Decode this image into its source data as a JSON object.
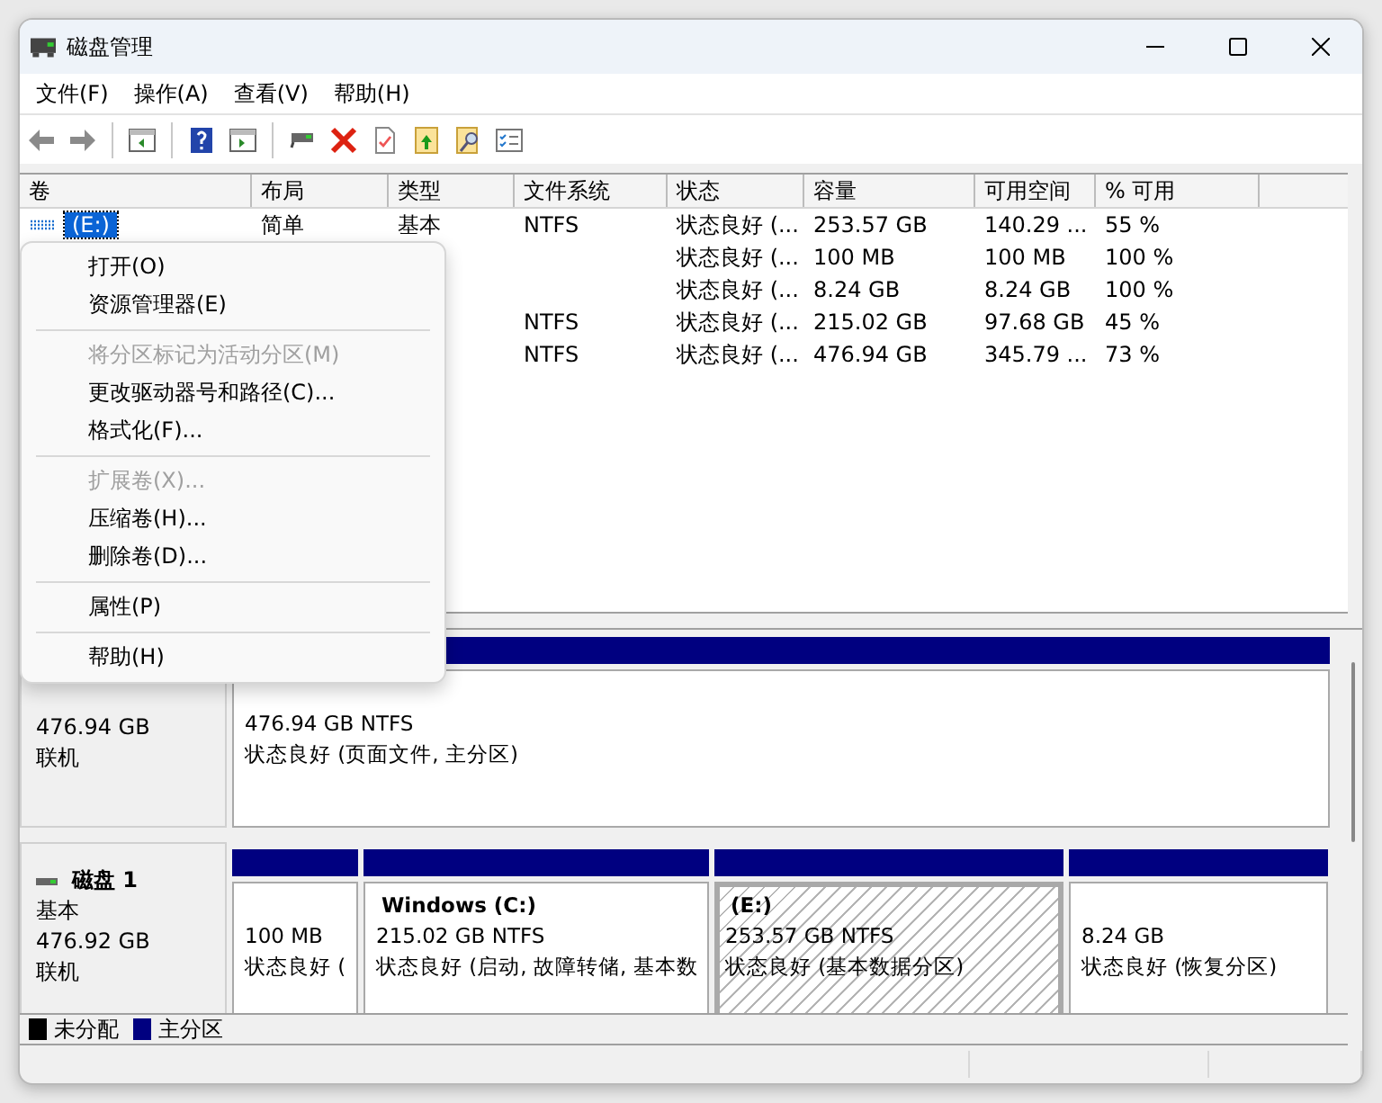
{
  "window": {
    "title": "磁盘管理"
  },
  "menu": [
    "文件(F)",
    "操作(A)",
    "查看(V)",
    "帮助(H)"
  ],
  "table": {
    "columns": [
      "卷",
      "布局",
      "类型",
      "文件系统",
      "状态",
      "容量",
      "可用空间",
      "% 可用"
    ],
    "rows": [
      {
        "selected": true,
        "volume": "(E:)",
        "layout": "简单",
        "type": "基本",
        "file_system": "NTFS",
        "status": "状态良好 (...",
        "capacity": "253.57 GB",
        "free_space": "140.29 ...",
        "percent_free": "55 %"
      },
      {
        "selected": false,
        "status": "状态良好 (...",
        "capacity": "100 MB",
        "free_space": "100 MB",
        "percent_free": "100 %"
      },
      {
        "selected": false,
        "status": "状态良好 (...",
        "capacity": "8.24 GB",
        "free_space": "8.24 GB",
        "percent_free": "100 %"
      },
      {
        "selected": false,
        "file_system": "NTFS",
        "status": "状态良好 (...",
        "capacity": "215.02 GB",
        "free_space": "97.68 GB",
        "percent_free": "45 %"
      },
      {
        "selected": false,
        "file_system": "NTFS",
        "status": "状态良好 (...",
        "capacity": "476.94 GB",
        "free_space": "345.79 ...",
        "percent_free": "73 %"
      }
    ]
  },
  "disks": [
    {
      "size": "476.94 GB",
      "status": "联机",
      "partitions": [
        {
          "size_fs": "476.94 GB NTFS",
          "state": "状态良好 (页面文件, 主分区)",
          "selected": false
        }
      ]
    },
    {
      "name": "磁盘 1",
      "type": "基本",
      "size": "476.92 GB",
      "status": "联机",
      "partitions": [
        {
          "size_fs": "100 MB",
          "state": "状态良好 (",
          "selected": false
        },
        {
          "label": "Windows  (C:)",
          "size_fs": "215.02 GB NTFS",
          "state": "状态良好 (启动, 故障转储, 基本数",
          "selected": false
        },
        {
          "label": "(E:)",
          "size_fs": "253.57 GB NTFS",
          "state": "状态良好 (基本数据分区)",
          "selected": true
        },
        {
          "size_fs": "8.24 GB",
          "state": "状态良好 (恢复分区)",
          "selected": false
        }
      ]
    }
  ],
  "legend": [
    {
      "label": "未分配",
      "color": "#000000"
    },
    {
      "label": "主分区",
      "color": "#000080"
    }
  ],
  "context_menu": {
    "items": [
      {
        "kind": "item",
        "label": "打开(O)",
        "disabled": false
      },
      {
        "kind": "item",
        "label": "资源管理器(E)",
        "disabled": false
      },
      {
        "kind": "separator"
      },
      {
        "kind": "item",
        "label": "将分区标记为活动分区(M)",
        "disabled": true
      },
      {
        "kind": "item",
        "label": "更改驱动器号和路径(C)...",
        "disabled": false
      },
      {
        "kind": "item",
        "label": "格式化(F)...",
        "disabled": false
      },
      {
        "kind": "separator"
      },
      {
        "kind": "item",
        "label": "扩展卷(X)...",
        "disabled": true
      },
      {
        "kind": "item",
        "label": "压缩卷(H)...",
        "disabled": false
      },
      {
        "kind": "item",
        "label": "删除卷(D)...",
        "disabled": false
      },
      {
        "kind": "separator"
      },
      {
        "kind": "item",
        "label": "属性(P)",
        "disabled": false
      },
      {
        "kind": "separator"
      },
      {
        "kind": "item",
        "label": "帮助(H)",
        "disabled": false
      }
    ]
  }
}
